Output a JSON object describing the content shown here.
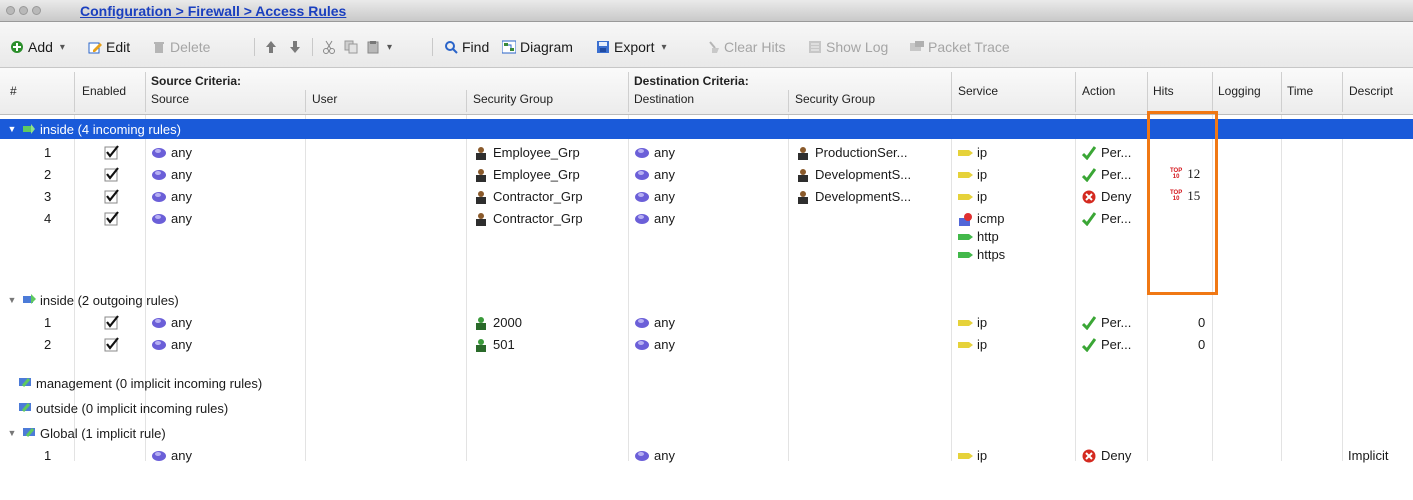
{
  "window": {
    "breadcrumb": "Configuration > Firewall > Access Rules"
  },
  "toolbar": {
    "add": "Add",
    "edit": "Edit",
    "delete": "Delete",
    "find": "Find",
    "diagram": "Diagram",
    "export": "Export",
    "clear_hits": "Clear Hits",
    "show_log": "Show Log",
    "packet_trace": "Packet Trace"
  },
  "columns": {
    "num": "#",
    "enabled": "Enabled",
    "source_criteria": "Source Criteria:",
    "destination_criteria": "Destination Criteria:",
    "source": "Source",
    "user": "User",
    "src_security_group": "Security Group",
    "destination": "Destination",
    "dst_security_group": "Security Group",
    "service": "Service",
    "action": "Action",
    "hits": "Hits",
    "logging": "Logging",
    "time": "Time",
    "description": "Descript"
  },
  "groups": [
    {
      "label": "inside (4 incoming rules)",
      "selected": true
    },
    {
      "label": "inside (2 outgoing rules)"
    },
    {
      "label": "management (0 implicit incoming rules)"
    },
    {
      "label": "outside (0 implicit incoming rules)"
    },
    {
      "label": "Global (1 implicit rule)"
    }
  ],
  "rules": [
    {
      "num": "1",
      "source": "any",
      "src_sg": "Employee_Grp",
      "destination": "any",
      "dst_sg": "ProductionSer...",
      "service": "ip",
      "action": "Per...",
      "hits": ""
    },
    {
      "num": "2",
      "source": "any",
      "src_sg": "Employee_Grp",
      "destination": "any",
      "dst_sg": "DevelopmentS...",
      "service": "ip",
      "action": "Per...",
      "hits_badge": "TOP 10",
      "hits": "12"
    },
    {
      "num": "3",
      "source": "any",
      "src_sg": "Contractor_Grp",
      "destination": "any",
      "dst_sg": "DevelopmentS...",
      "service": "ip",
      "action": "Deny",
      "hits_badge": "TOP 10",
      "hits": "15"
    },
    {
      "num": "4",
      "source": "any",
      "src_sg": "Contractor_Grp",
      "destination": "any",
      "dst_sg": "",
      "services": [
        "icmp",
        "http",
        "https"
      ],
      "action": "Per...",
      "hits": ""
    },
    {
      "num": "1",
      "source": "any",
      "src_sg": "2000",
      "destination": "any",
      "service": "ip",
      "action": "Per...",
      "hits": "0"
    },
    {
      "num": "2",
      "source": "any",
      "src_sg": "501",
      "destination": "any",
      "service": "ip",
      "action": "Per...",
      "hits": "0"
    },
    {
      "num": "1",
      "source": "any",
      "destination": "any",
      "service": "ip",
      "action": "Deny",
      "description": "Implicit"
    }
  ],
  "colors": {
    "selection": "#1a5ad9",
    "highlight_box": "#f07814",
    "link": "#1a3fbf",
    "permit": "#3aa635",
    "deny": "#d42a20"
  }
}
